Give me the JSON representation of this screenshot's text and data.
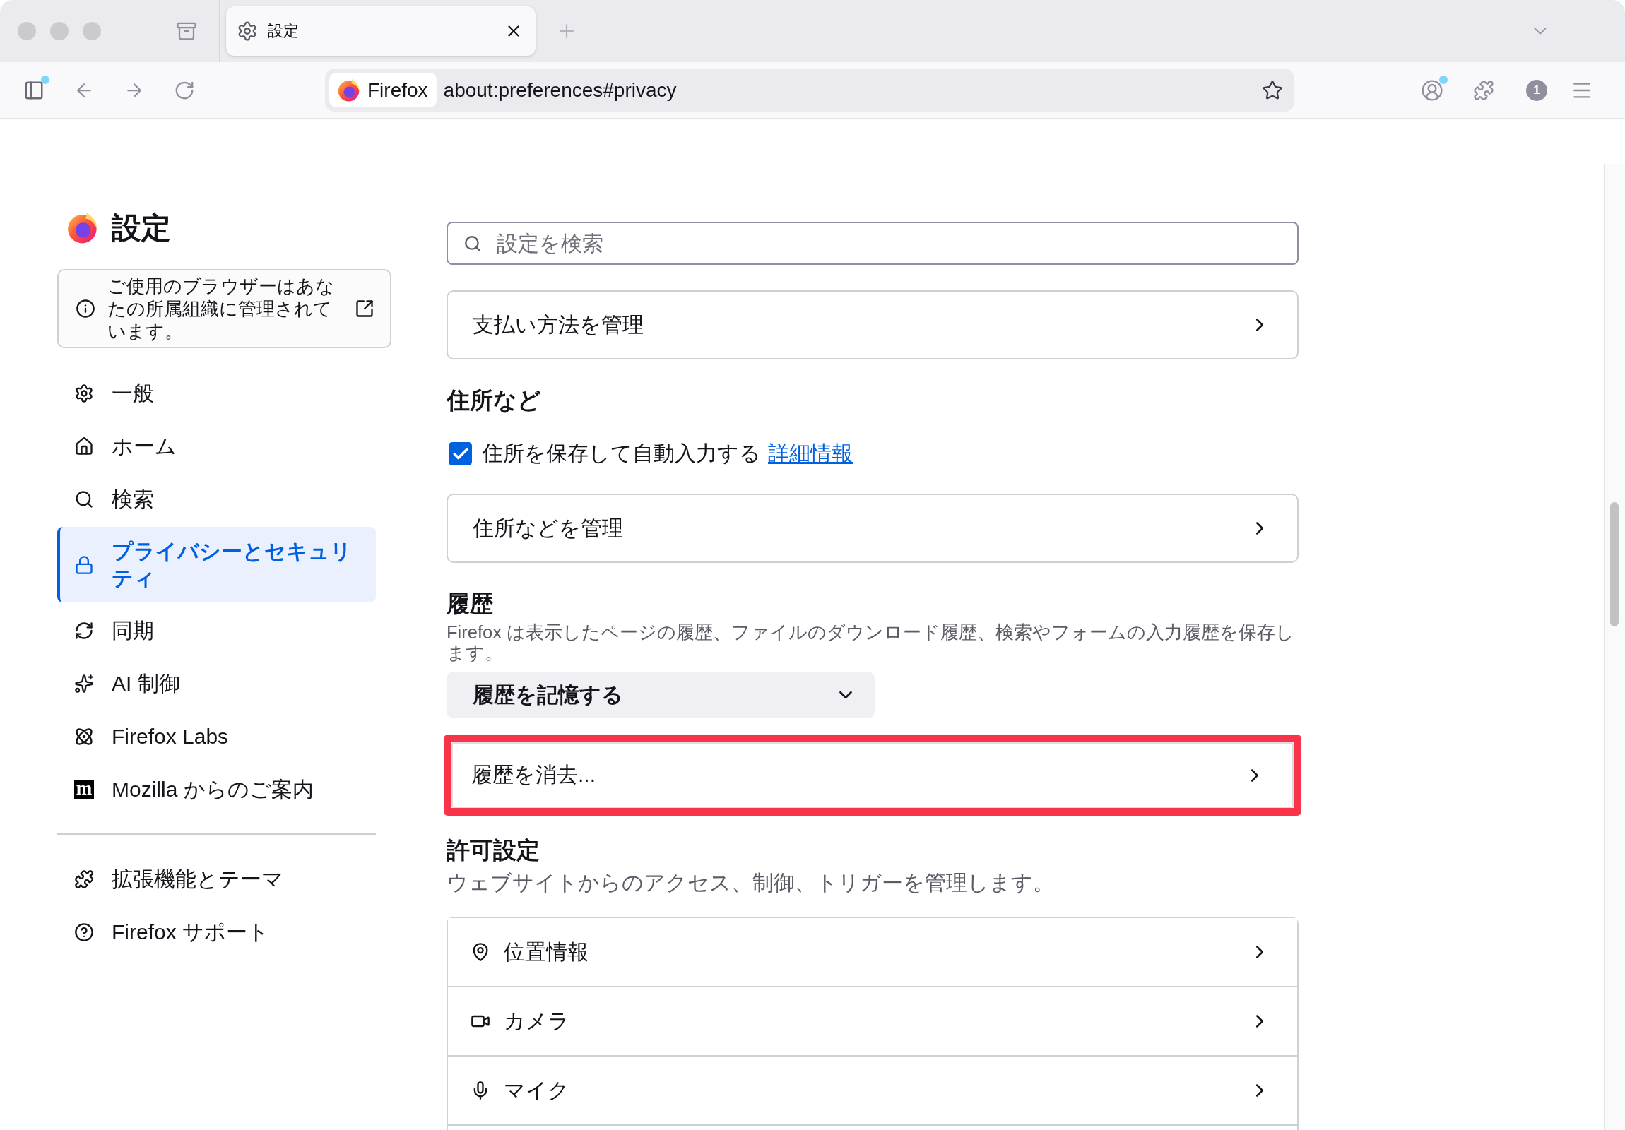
{
  "tabs": [
    {
      "title": "設定",
      "selected": true
    }
  ],
  "toolbar": {
    "sidebar_notification": true,
    "identity": "Firefox",
    "url": "about:preferences#privacy",
    "account_notification": true,
    "extension_badge": "1"
  },
  "sidebar": {
    "title": "設定",
    "notice": "ご使用のブラウザーはあなたの所属組織に管理されています。",
    "items": [
      {
        "label": "一般",
        "selected": false
      },
      {
        "label": "ホーム",
        "selected": false
      },
      {
        "label": "検索",
        "selected": false
      },
      {
        "label": "プライバシーとセキュリティ",
        "selected": true
      },
      {
        "label": "同期",
        "selected": false
      },
      {
        "label": "AI 制御",
        "selected": false
      },
      {
        "label": "Firefox Labs",
        "selected": false
      },
      {
        "label": "Mozilla からのご案内",
        "selected": false,
        "logo_text": "m"
      }
    ],
    "footer_items": [
      {
        "label": "拡張機能とテーマ"
      },
      {
        "label": "Firefox サポート"
      }
    ]
  },
  "search": {
    "placeholder": "設定を検索"
  },
  "sections": [
    {
      "kind": "nav_card",
      "label": "支払い方法を管理",
      "highlighted": false
    },
    {
      "kind": "heading",
      "text": "住所など"
    },
    {
      "kind": "checkbox",
      "label": "住所を保存して自動入力する",
      "link": "詳細情報",
      "checked": true
    },
    {
      "kind": "nav_card",
      "label": "住所などを管理",
      "highlighted": false
    },
    {
      "kind": "heading",
      "text": "履歴",
      "note": "Firefox は表示したページの履歴、ファイルのダウンロード履歴、検索やフォームの入力履歴を保存します。"
    },
    {
      "kind": "dropdown",
      "value": "履歴を記憶する"
    },
    {
      "kind": "nav_card",
      "label": "履歴を消去...",
      "highlighted": true
    },
    {
      "kind": "heading",
      "text": "許可設定",
      "description": "ウェブサイトからのアクセス、制御、トリガーを管理します。"
    },
    {
      "kind": "list_card",
      "rows": [
        {
          "label": "位置情報"
        },
        {
          "label": "カメラ"
        },
        {
          "label": "マイク"
        }
      ]
    }
  ]
}
